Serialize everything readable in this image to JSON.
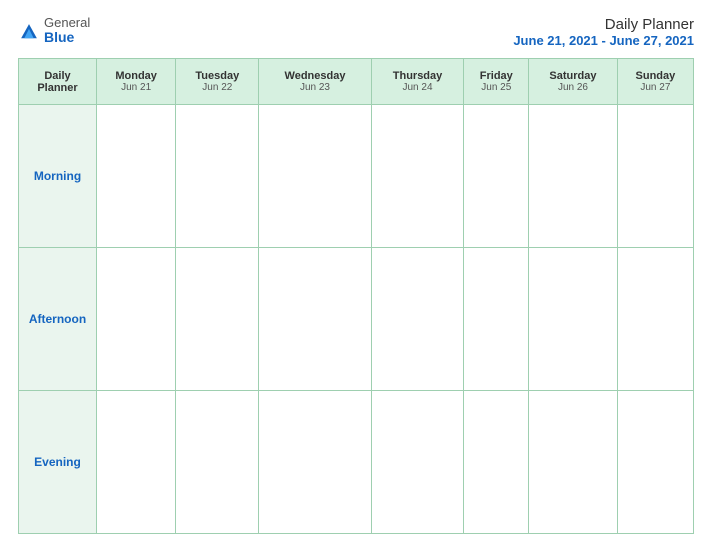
{
  "logo": {
    "general": "General",
    "blue": "Blue",
    "icon_color": "#1565c0"
  },
  "title": {
    "main": "Daily Planner",
    "date_range": "June 21, 2021 - June 27, 2021"
  },
  "columns": [
    {
      "label": "Daily\nPlanner",
      "date": ""
    },
    {
      "label": "Monday",
      "date": "Jun 21"
    },
    {
      "label": "Tuesday",
      "date": "Jun 22"
    },
    {
      "label": "Wednesday",
      "date": "Jun 23"
    },
    {
      "label": "Thursday",
      "date": "Jun 24"
    },
    {
      "label": "Friday",
      "date": "Jun 25"
    },
    {
      "label": "Saturday",
      "date": "Jun 26"
    },
    {
      "label": "Sunday",
      "date": "Jun 27"
    }
  ],
  "rows": [
    {
      "label": "Morning"
    },
    {
      "label": "Afternoon"
    },
    {
      "label": "Evening"
    }
  ]
}
